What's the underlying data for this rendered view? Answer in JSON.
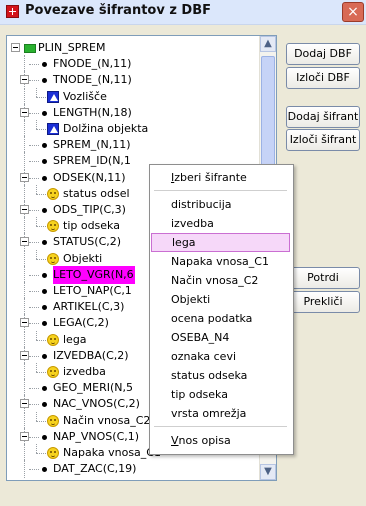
{
  "window": {
    "title": "Povezave šifrantov z DBF",
    "close_label": "×",
    "accent": "#dbe7fb"
  },
  "tree": {
    "rows": [
      {
        "label": "PLIN_SPREM",
        "icon": "green-folder-icon"
      },
      {
        "label": "FNODE_(N,11)",
        "icon": "bullet-icon"
      },
      {
        "label": "TNODE_(N,11)",
        "icon": "bullet-icon"
      },
      {
        "label": "Vozlišče",
        "icon": "triangle-icon"
      },
      {
        "label": "LENGTH(N,18)",
        "icon": "bullet-icon"
      },
      {
        "label": "Dolžina objekta",
        "icon": "triangle-icon"
      },
      {
        "label": "SPREM_(N,11)",
        "icon": "bullet-icon"
      },
      {
        "label": "SPREM_ID(N,1",
        "icon": "bullet-icon"
      },
      {
        "label": "ODSEK(N,11)",
        "icon": "bullet-icon"
      },
      {
        "label": "status odsel",
        "icon": "smiley-icon"
      },
      {
        "label": "ODS_TIP(C,3)",
        "icon": "bullet-icon"
      },
      {
        "label": "tip odseka",
        "icon": "smiley-icon"
      },
      {
        "label": "STATUS(C,2)",
        "icon": "bullet-icon"
      },
      {
        "label": "Objekti",
        "icon": "smiley-icon"
      },
      {
        "label": "LETO_VGR(N,6",
        "icon": "bullet-icon",
        "highlight": "#ff00ff"
      },
      {
        "label": "LETO_NAP(C,1",
        "icon": "bullet-icon"
      },
      {
        "label": "ARTIKEL(C,3)",
        "icon": "bullet-icon"
      },
      {
        "label": "LEGA(C,2)",
        "icon": "bullet-icon"
      },
      {
        "label": "lega",
        "icon": "smiley-icon"
      },
      {
        "label": "IZVEDBA(C,2)",
        "icon": "bullet-icon"
      },
      {
        "label": "izvedba",
        "icon": "smiley-icon"
      },
      {
        "label": "GEO_MERI(N,5",
        "icon": "bullet-icon"
      },
      {
        "label": "NAC_VNOS(C,2)",
        "icon": "bullet-icon"
      },
      {
        "label": "Način vnosa_C2",
        "icon": "smiley-icon"
      },
      {
        "label": "NAP_VNOS(C,1)",
        "icon": "bullet-icon"
      },
      {
        "label": "Napaka vnosa_C1",
        "icon": "smiley-icon"
      },
      {
        "label": "DAT_ZAC(C,19)",
        "icon": "bullet-icon"
      }
    ]
  },
  "buttons": {
    "dodaj_dbf": "Dodaj DBF",
    "izloci_dbf": "Izloči DBF",
    "dodaj_sifrant": "Dodaj šifrant",
    "izloci_sifrant": "Izloči šifrant",
    "potrdi": "Potrdi",
    "preklici": "Prekliči"
  },
  "context_menu": {
    "header": "Izberi šifrante",
    "items": [
      "distribucija",
      "izvedba",
      "lega",
      "Napaka vnosa_C1",
      "Način vnosa_C2",
      "Objekti",
      "ocena podatka",
      "OSEBA_N4",
      "oznaka cevi",
      "status odseka",
      "tip odseka",
      "vrsta omrežja"
    ],
    "selected": "lega",
    "footer": "Vnos opisa"
  }
}
